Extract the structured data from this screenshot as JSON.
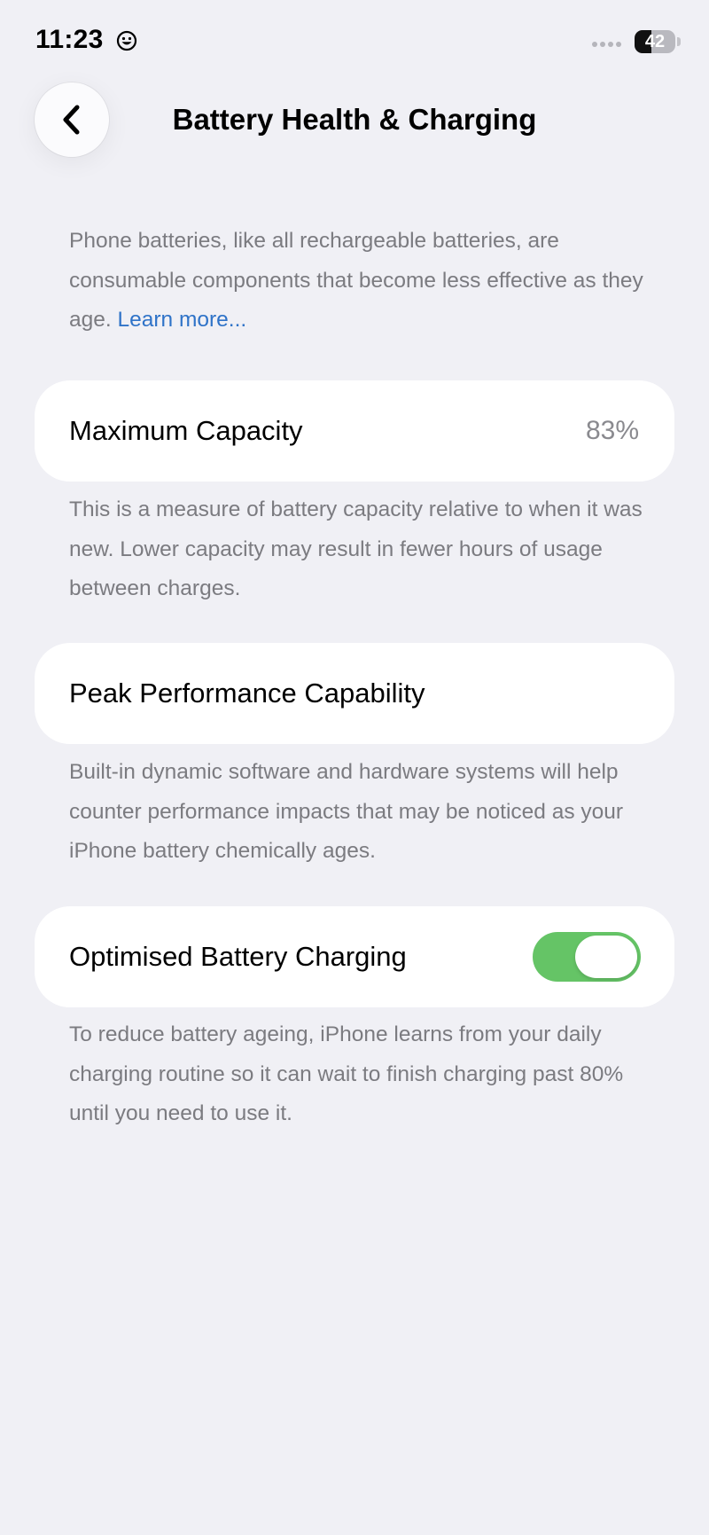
{
  "status_bar": {
    "time": "11:23",
    "battery_level": "42",
    "battery_fraction": 0.42
  },
  "nav": {
    "title": "Battery Health & Charging",
    "back_icon": "chevron-left-icon"
  },
  "intro": {
    "text": "Phone batteries, like all rechargeable batteries, are consumable components that become less effective as they age.",
    "link": "Learn more..."
  },
  "max_capacity": {
    "label": "Maximum Capacity",
    "value": "83%",
    "description": "This is a measure of battery capacity relative to when it was new. Lower capacity may result in fewer hours of usage between charges."
  },
  "peak_performance": {
    "label": "Peak Performance Capability",
    "description": "Built-in dynamic software and hardware systems will help counter performance impacts that may be noticed as your iPhone battery chemically ages."
  },
  "optimised_charging": {
    "label": "Optimised Battery Charging",
    "enabled": true,
    "description": "To reduce battery ageing, iPhone learns from your daily charging routine so it can wait to finish charging past 80% until you need to use it."
  },
  "colors": {
    "background": "#f0f0f5",
    "toggle_on": "#65c466",
    "link": "#2f73c8",
    "secondary_text": "#7b7b80"
  }
}
